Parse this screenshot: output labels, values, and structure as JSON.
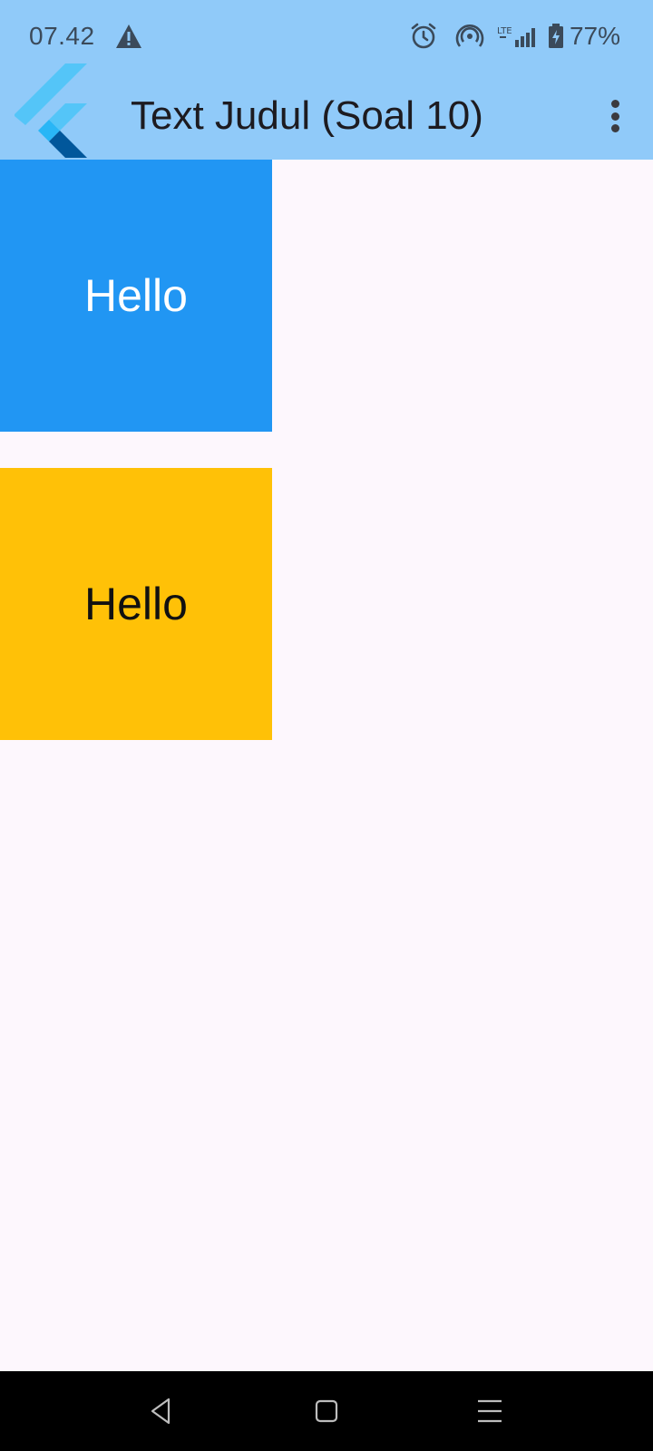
{
  "status_bar": {
    "time": "07.42",
    "battery_percent": "77%",
    "network_label": "LTE",
    "icons": [
      "warning-icon",
      "alarm-icon",
      "hotspot-icon",
      "signal-icon",
      "battery-charging-icon"
    ]
  },
  "app_bar": {
    "title": "Text Judul (Soal 10)",
    "logo": "flutter-logo",
    "menu_icon": "more-vert-icon",
    "background": "#90caf9"
  },
  "boxes": [
    {
      "label": "Hello",
      "background": "#2196f3",
      "text_color": "#ffffff"
    },
    {
      "label": "Hello",
      "background": "#ffc107",
      "text_color": "#111111"
    }
  ],
  "nav_bar": {
    "buttons": [
      "back-icon",
      "home-icon",
      "recents-icon"
    ]
  }
}
